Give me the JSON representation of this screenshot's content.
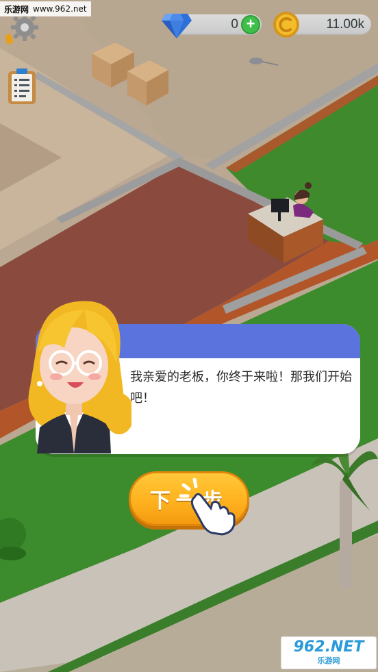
{
  "watermark_top": {
    "site": "乐游网",
    "url": "www.962.net"
  },
  "hud": {
    "gems": "0",
    "coins": "11.00k",
    "add_gems_symbol": "+"
  },
  "icons": {
    "settings": "gear-icon",
    "tasks": "clipboard-icon",
    "gem": "diamond-icon",
    "coin": "coin-icon",
    "hand": "tap-hand-icon"
  },
  "dialog": {
    "text": "我亲爱的老板，你终于来啦！那我们开始吧！"
  },
  "next_button": {
    "label": "下一步"
  },
  "watermark_bottom": {
    "logo_num": "962",
    "logo_suffix": ".NET",
    "logo_text": "乐游网"
  },
  "colors": {
    "floor": "#8a4b3e",
    "grass": "#3f8a2d",
    "dialog_band": "#5b73dc",
    "button": "#ffb21f",
    "plus": "#3fbf4a"
  }
}
